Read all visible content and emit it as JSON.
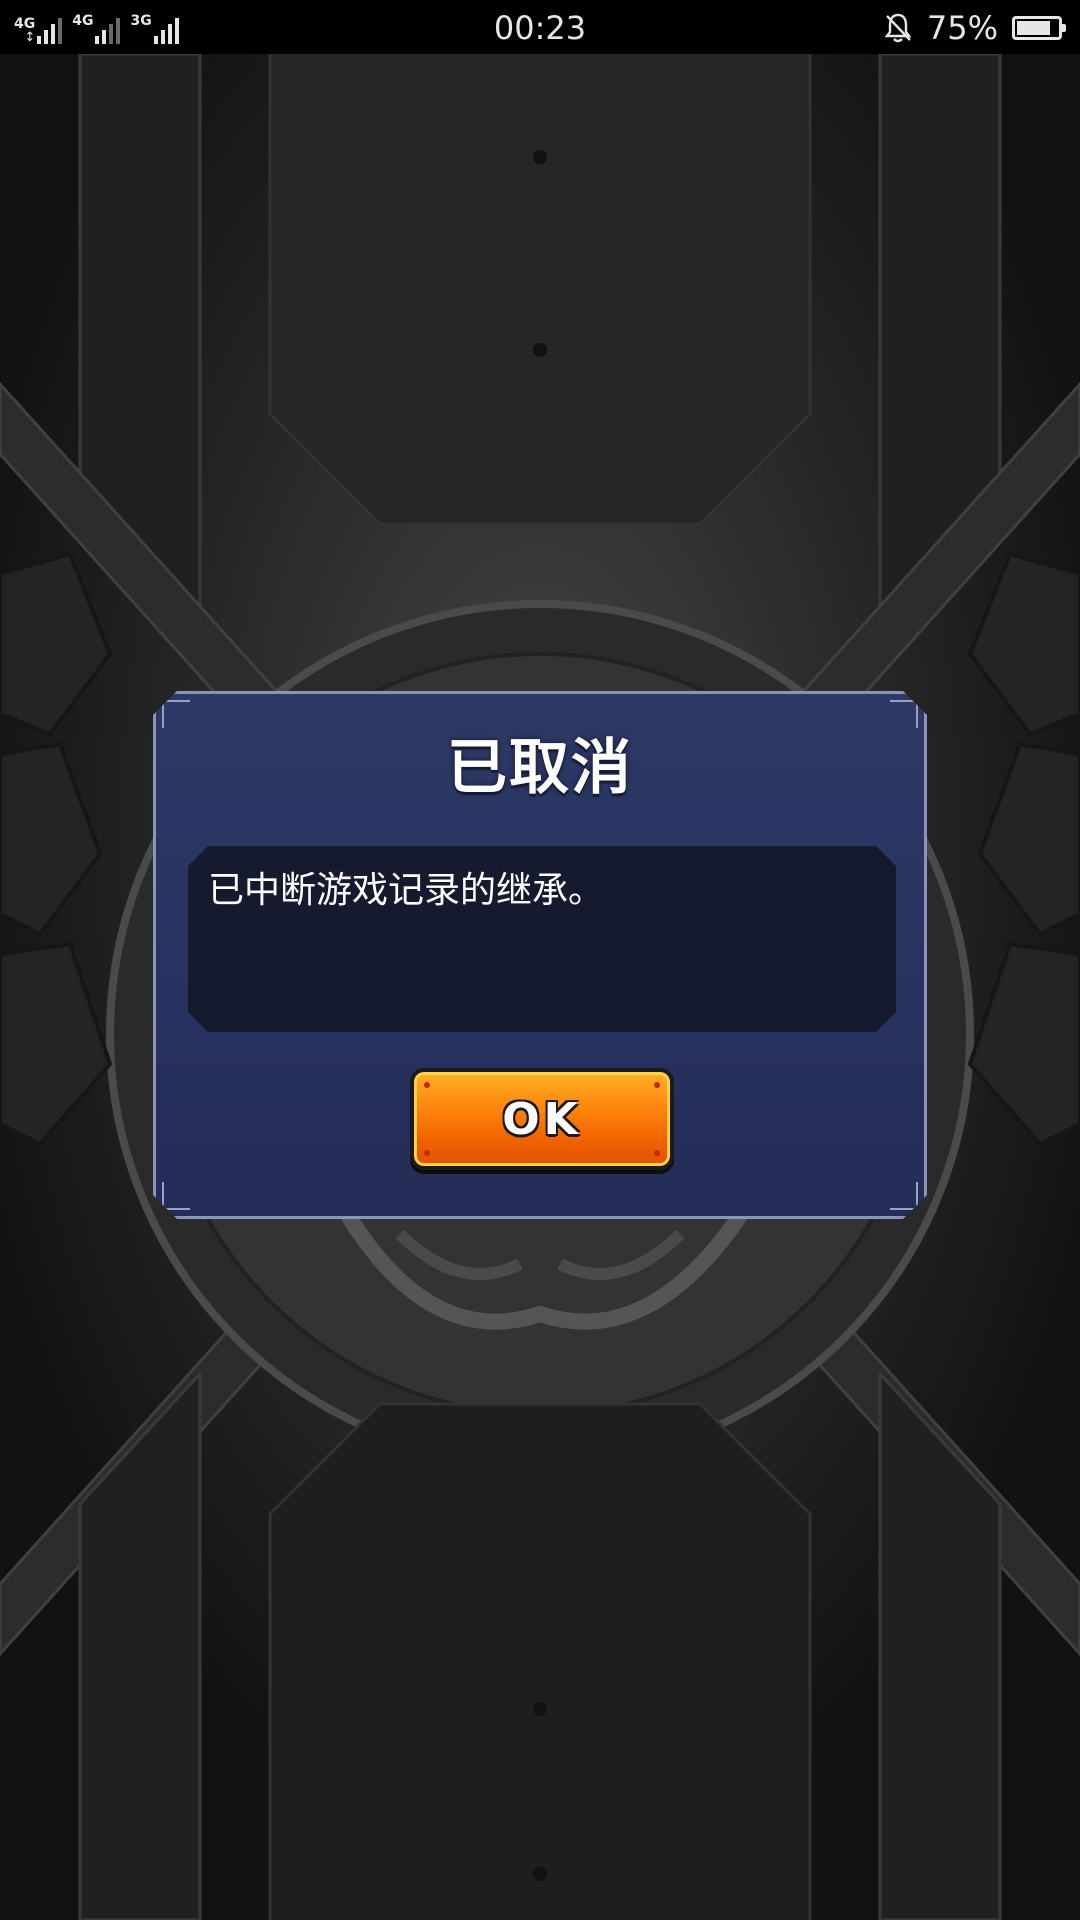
{
  "status_bar": {
    "networks": [
      {
        "label": "4G",
        "bars": 3,
        "icon": "signal-icon",
        "arrows": "↕"
      },
      {
        "label": "4G",
        "bars": 2,
        "icon": "signal-icon"
      },
      {
        "label": "3G",
        "bars": 3,
        "icon": "signal-icon"
      }
    ],
    "time": "00:23",
    "bell_icon": "bell-off-icon",
    "battery_percent": "75%",
    "battery_level": 0.75,
    "battery_icon": "battery-icon"
  },
  "dialog": {
    "title": "已取消",
    "message": "已中断游戏记录的继承。",
    "ok_label": "OK",
    "colors": {
      "panel": "#2b3562",
      "message_bg": "#151a2e",
      "button": "#f26400",
      "button_border": "#ffd24a"
    }
  },
  "background": {
    "theme_colors": [
      "#3d3d3d",
      "#151515"
    ]
  }
}
